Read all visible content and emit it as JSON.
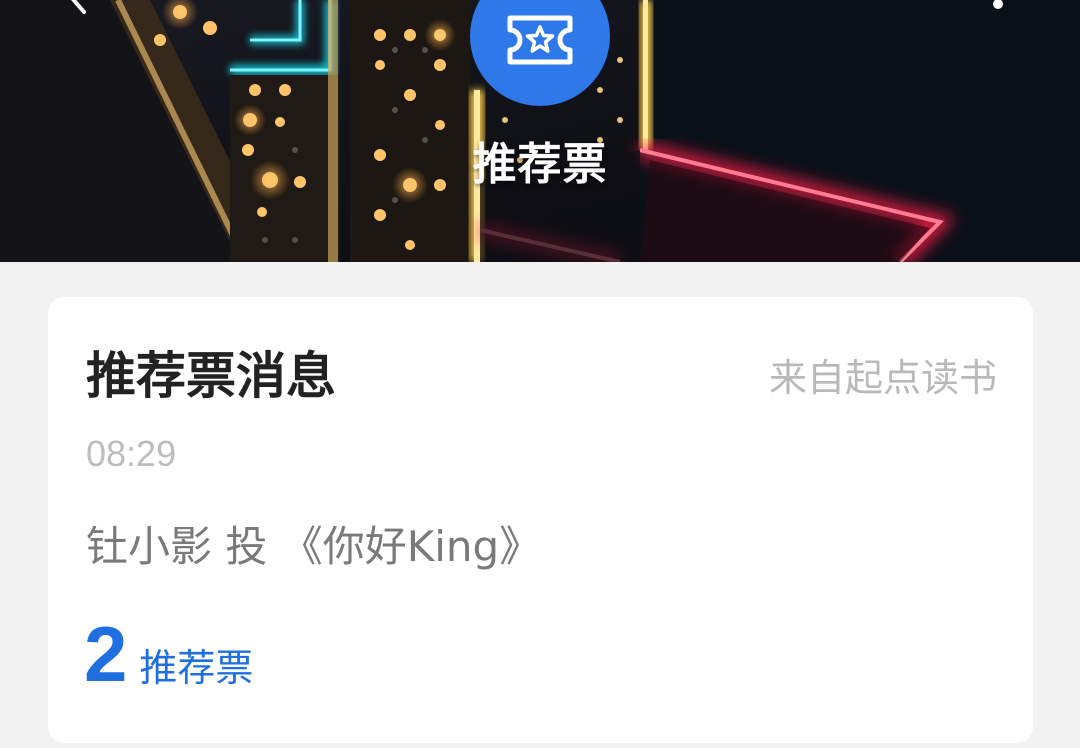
{
  "header": {
    "title": "推荐票",
    "icons": {
      "back": "chevron-left-icon",
      "more": "more-vertical-icon",
      "badge": "ticket-star-icon"
    },
    "colors": {
      "badge": "#2f78ea"
    }
  },
  "message_card": {
    "title": "推荐票消息",
    "source": "来自起点读书",
    "time": "08:29",
    "message": "钍小影 投 《你好King》",
    "count": "2",
    "count_unit": "推荐票",
    "colors": {
      "accent": "#1f6fe0",
      "muted": "#bdbdbd",
      "body": "#7a7a7a"
    }
  }
}
